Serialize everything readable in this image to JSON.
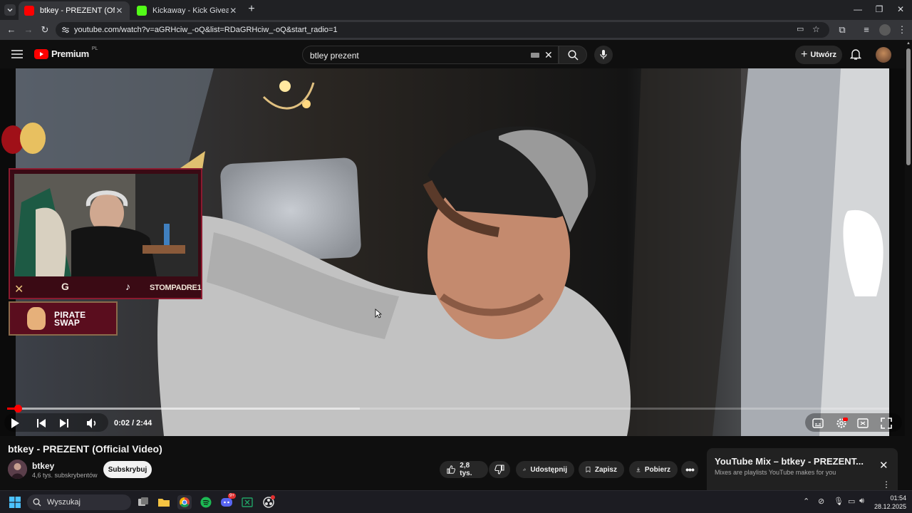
{
  "browser": {
    "tabs": [
      {
        "label": "btkey - PREZENT (Official Video",
        "active": true
      },
      {
        "label": "Kickaway - Kick Giveaway Tool",
        "active": false
      }
    ],
    "url": "youtube.com/watch?v=aGRHciw_-oQ&list=RDaGRHciw_-oQ&start_radio=1"
  },
  "header": {
    "logo": "Premium",
    "logo_badge": "PL",
    "search_value": "btley prezent",
    "create_label": "Utwórz"
  },
  "video": {
    "current_time": "0:02",
    "duration": "2:44",
    "time_display": "0:02 / 2:44",
    "progress_fraction": 0.012,
    "buffer_fraction": 0.4,
    "overlay": {
      "streamer_handle": "STOMPADRE1",
      "sponsor": "PIRATE SWAP"
    }
  },
  "meta": {
    "title": "btkey - PREZENT (Official Video)",
    "channel": "btkey",
    "subscribers": "4,6 tys. subskrybentów",
    "subscribe_label": "Subskrybuj",
    "likes": "2,8 tys.",
    "share_label": "Udostępnij",
    "save_label": "Zapisz",
    "download_label": "Pobierz"
  },
  "mix": {
    "title": "YouTube Mix – btkey - PREZENT...",
    "subtitle": "Mixes are playlists YouTube makes for you"
  },
  "taskbar": {
    "search_placeholder": "Wyszukaj",
    "discord_badge": "9+",
    "time": "01:54",
    "date": "28.12.2025"
  },
  "colors": {
    "accent": "#ff0000",
    "background": "#0f0f0f",
    "overlay_red": "#8b1a2f"
  }
}
